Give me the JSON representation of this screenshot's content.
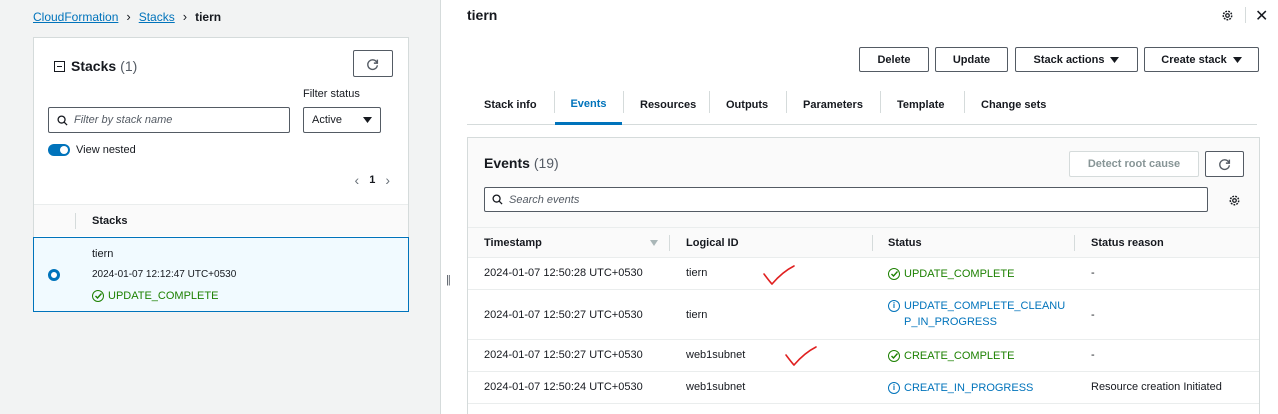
{
  "breadcrumb": {
    "root": "CloudFormation",
    "stacks": "Stacks",
    "current": "tiern"
  },
  "stacks_panel": {
    "title": "Stacks",
    "count": "(1)",
    "filter_label": "Filter status",
    "filter_value": "Active",
    "search_placeholder": "Filter by stack name",
    "view_nested_label": "View nested",
    "page": "1",
    "column_header": "Stacks",
    "rows": [
      {
        "name": "tiern",
        "time": "2024-01-07 12:12:47 UTC+0530",
        "status": "UPDATE_COMPLETE"
      }
    ]
  },
  "header": {
    "title": "tiern"
  },
  "actions": {
    "delete": "Delete",
    "update": "Update",
    "stack_actions": "Stack actions",
    "create_stack": "Create stack"
  },
  "tabs": [
    {
      "label": "Stack info"
    },
    {
      "label": "Events"
    },
    {
      "label": "Resources"
    },
    {
      "label": "Outputs"
    },
    {
      "label": "Parameters"
    },
    {
      "label": "Template"
    },
    {
      "label": "Change sets"
    }
  ],
  "events": {
    "title": "Events",
    "count": "(19)",
    "detect_label": "Detect root cause",
    "search_placeholder": "Search events",
    "columns": {
      "timestamp": "Timestamp",
      "logical_id": "Logical ID",
      "status": "Status",
      "reason": "Status reason"
    },
    "rows": [
      {
        "timestamp": "2024-01-07 12:50:28 UTC+0530",
        "logical_id": "tiern",
        "status_l1": "UPDATE_COMPLETE",
        "status_l2": "",
        "reason": "-"
      },
      {
        "timestamp": "2024-01-07 12:50:27 UTC+0530",
        "logical_id": "tiern",
        "status_l1": "UPDATE_COMPLETE_CLEANU",
        "status_l2": "P_IN_PROGRESS",
        "reason": "-"
      },
      {
        "timestamp": "2024-01-07 12:50:27 UTC+0530",
        "logical_id": "web1subnet",
        "status_l1": "CREATE_COMPLETE",
        "status_l2": "",
        "reason": "-"
      },
      {
        "timestamp": "2024-01-07 12:50:24 UTC+0530",
        "logical_id": "web1subnet",
        "status_l1": "CREATE_IN_PROGRESS",
        "status_l2": "",
        "reason": "Resource creation Initiated"
      }
    ]
  },
  "colors": {
    "link": "#0073bb",
    "success": "#1d8102",
    "annotation": "#e02020"
  }
}
